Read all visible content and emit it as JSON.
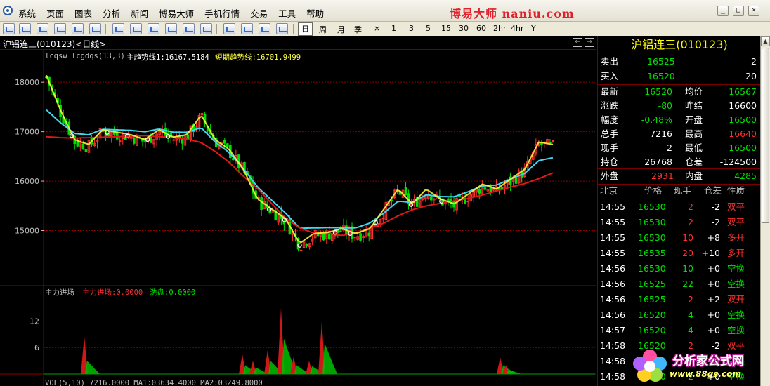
{
  "menu": {
    "items": [
      "系统",
      "页面",
      "图表",
      "分析",
      "新闻",
      "博易大师",
      "手机行情",
      "交易",
      "工具",
      "帮助"
    ],
    "brand": "博易大师 naniu.com"
  },
  "toolbar": {
    "periods": [
      "日",
      "周",
      "月",
      "季",
      "×",
      "1",
      "3",
      "5",
      "15",
      "30",
      "60",
      "2hr",
      "4hr",
      "Y"
    ],
    "active_period": "日"
  },
  "chart": {
    "title": "沪铝连三(010123)<日线>",
    "indicator_line": {
      "names": "lcqsw  lcgdqs(13,3)",
      "main_label": "主趋势线1:16167.5184",
      "short_label": "短期趋势线:16701.9499"
    },
    "sub_indicator": {
      "name": "主力进场",
      "main_label": "主力进场:0.0000",
      "wash_label": "洗盘:0.0000"
    },
    "vol_label": "VOL(5,10) 7216.0000   MA1:03634.4000   MA2:03249.8000",
    "colors": {
      "up_candle": "#ff3030",
      "down_candle": "#00e000",
      "main_trend": "#e01818",
      "mid_trend": "#40d8f0",
      "short_trend": "#ffff40",
      "grid": "#8c0000"
    }
  },
  "chart_data": [
    {
      "type": "line",
      "title": "沪铝连三(010123)<日线>",
      "y_ticks": [
        15000,
        16000,
        17000,
        18000
      ],
      "ylim": [
        13900,
        18400
      ],
      "series": [
        {
          "name": "主趋势线1",
          "values": [
            16900,
            16880,
            16870,
            16880,
            16890,
            16900,
            16910,
            16920,
            16900,
            16880,
            16850,
            16780,
            16600,
            16380,
            16100,
            15850,
            15550,
            15250,
            15050,
            14950,
            14950,
            14900,
            14950,
            15050,
            15150,
            15300,
            15420,
            15500,
            15550,
            15600,
            15650,
            15720,
            15800,
            15880,
            15950,
            16050,
            16167
          ]
        },
        {
          "name": "短期趋势线",
          "values": [
            18100,
            17400,
            16800,
            16700,
            17000,
            16950,
            16900,
            16800,
            17000,
            16850,
            16900,
            17300,
            16800,
            16600,
            16200,
            15600,
            15400,
            15200,
            14700,
            14900,
            14920,
            15000,
            14900,
            15000,
            15400,
            15800,
            15500,
            15800,
            15600,
            15500,
            15700,
            15900,
            15800,
            16000,
            16200,
            16750,
            16701
          ]
        }
      ]
    },
    {
      "type": "bar",
      "title": "主力进场",
      "y_ticks": [
        6,
        12
      ],
      "ylim": [
        0,
        17
      ],
      "x": [
        120,
        345,
        360,
        381,
        400,
        418,
        440,
        458,
        712,
        720
      ],
      "values": [
        8.6,
        4.5,
        3,
        5.5,
        15,
        4,
        3,
        12,
        3.8,
        2
      ],
      "series": [
        {
          "name": "洗盘",
          "values": [
            3,
            2,
            1.5,
            3,
            8,
            2,
            1.8,
            7,
            2,
            1
          ]
        }
      ]
    }
  ],
  "quote": {
    "title": "沪铝连三(010123)",
    "rows": [
      {
        "l1": "卖出",
        "v1": "16525",
        "r1": "2",
        "c1": "#00e000"
      },
      {
        "l1": "买入",
        "v1": "16520",
        "r1": "20",
        "c1": "#00e000"
      }
    ],
    "grid": [
      [
        "最新",
        "16520",
        "均价",
        "16567"
      ],
      [
        "涨跌",
        "-80",
        "昨结",
        "16600"
      ],
      [
        "幅度",
        "-0.48%",
        "开盘",
        "16500"
      ],
      [
        "总手",
        "7216",
        "最高",
        "16640"
      ],
      [
        "现手",
        "2",
        "最低",
        "16500"
      ],
      [
        "持仓",
        "26768",
        "仓差",
        "-124500"
      ]
    ],
    "grid_colors": [
      [
        "#00e000",
        "#00e000"
      ],
      [
        "#00e000",
        "#ffffff"
      ],
      [
        "#00e000",
        "#00e000"
      ],
      [
        "#ffffff",
        "#ff3030"
      ],
      [
        "#ffffff",
        "#00e000"
      ],
      [
        "#ffffff",
        "#ffffff"
      ]
    ],
    "outer": {
      "label": "外盘",
      "value": "2931",
      "inner_label": "内盘",
      "inner_value": "4285"
    },
    "tick_headers": [
      "北京",
      "价格",
      "现手",
      "仓差",
      "性质"
    ],
    "ticks": [
      [
        "14:55",
        "16530",
        "2",
        "-2",
        "双平"
      ],
      [
        "14:55",
        "16530",
        "2",
        "-2",
        "双平"
      ],
      [
        "14:55",
        "16530",
        "10",
        "+8",
        "多开"
      ],
      [
        "14:55",
        "16535",
        "20",
        "+10",
        "多开"
      ],
      [
        "14:56",
        "16530",
        "10",
        "+0",
        "空换"
      ],
      [
        "14:56",
        "16525",
        "22",
        "+0",
        "空换"
      ],
      [
        "14:56",
        "16525",
        "2",
        "+2",
        "双开"
      ],
      [
        "14:56",
        "16520",
        "4",
        "+0",
        "空换"
      ],
      [
        "14:57",
        "16520",
        "4",
        "+0",
        "空换"
      ],
      [
        "14:58",
        "16520",
        "2",
        "-2",
        "双平"
      ],
      [
        "14:58",
        "16520",
        "2",
        "+0",
        "空换"
      ],
      [
        "14:58",
        "16520",
        "2",
        "+0",
        "空换"
      ]
    ]
  },
  "logo": {
    "text": "分析家公式网",
    "url": "www.88gs.com"
  }
}
